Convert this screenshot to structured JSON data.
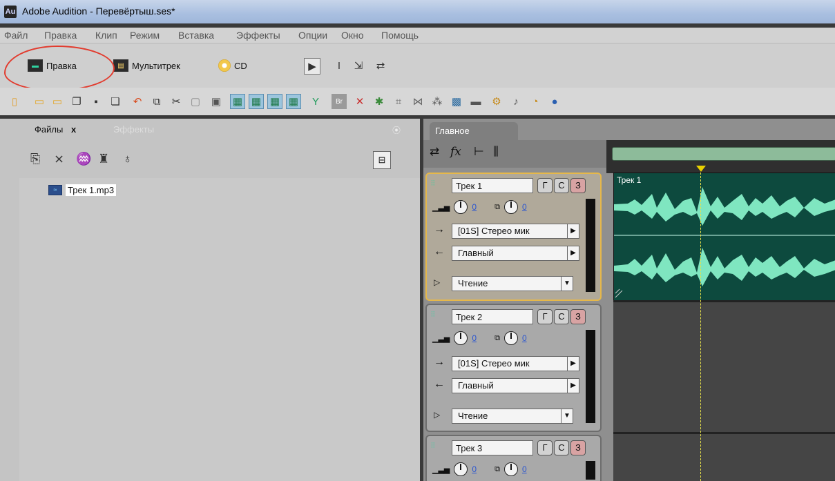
{
  "window": {
    "logo": "Au",
    "title": "Adobe Audition - Перевёртыш.ses*"
  },
  "menu": [
    "Файл",
    "Правка",
    "Клип",
    "Режим",
    "Вставка",
    "Эффекты",
    "Опции",
    "Окно",
    "Помощь"
  ],
  "workspace": {
    "edit": "Правка",
    "multitrack": "Мультитрек",
    "cd": "CD"
  },
  "left_panel": {
    "tab_files": "Файлы",
    "tab_files_close": "x",
    "tab_effects": "Эффекты",
    "files": [
      {
        "name": "Трек 1.mp3"
      }
    ]
  },
  "right_panel": {
    "tab_main": "Главное"
  },
  "tracks": [
    {
      "name": "Трек 1",
      "btn_g": "Г",
      "btn_c": "С",
      "btn_z": "З",
      "vol": "0",
      "pan": "0",
      "input": "[01S] Стерео мик",
      "output": "Главный",
      "automation": "Чтение"
    },
    {
      "name": "Трек 2",
      "btn_g": "Г",
      "btn_c": "С",
      "btn_z": "З",
      "vol": "0",
      "pan": "0",
      "input": "[01S] Стерео мик",
      "output": "Главный",
      "automation": "Чтение"
    },
    {
      "name": "Трек 3",
      "btn_g": "Г",
      "btn_c": "С",
      "btn_z": "З",
      "vol": "0",
      "pan": "0"
    }
  ],
  "timeline": {
    "clip_label": "Трек 1"
  },
  "colors": {
    "waveform": "#7fe6c0",
    "clip_bg": "#0d4a3e",
    "annotation": "#e23b2e",
    "selected_track": "#e6b84a"
  }
}
